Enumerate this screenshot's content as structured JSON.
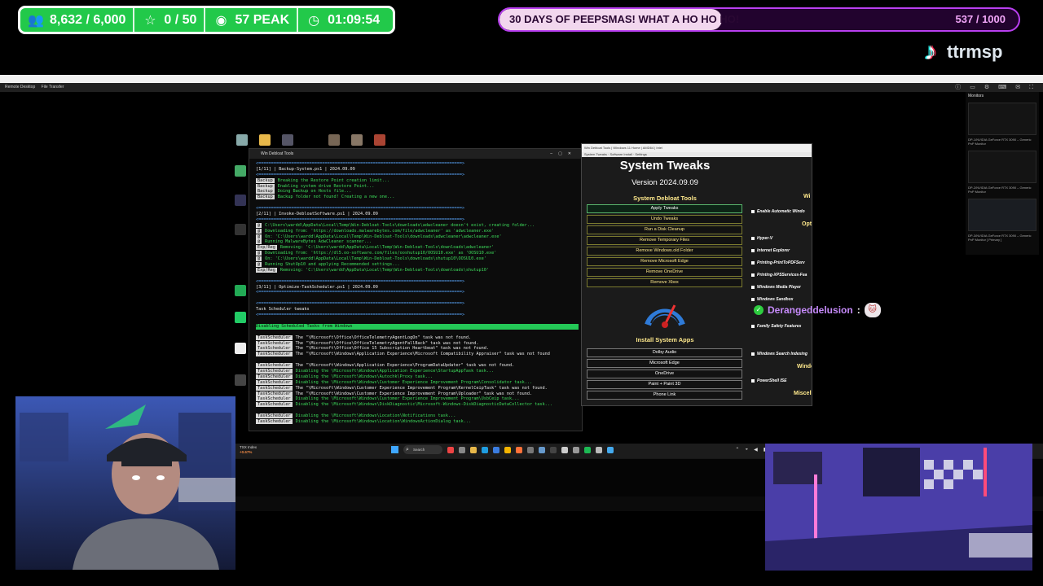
{
  "overlay": {
    "stats": [
      {
        "icon": "users-icon",
        "glyph": "👥",
        "value": "8,632 / 6,000"
      },
      {
        "icon": "star-icon",
        "glyph": "☆",
        "value": "0 / 50"
      },
      {
        "icon": "eye-icon",
        "glyph": "◉",
        "value": "57 PEAK"
      },
      {
        "icon": "clock-icon",
        "glyph": "◷",
        "value": "01:09:54"
      }
    ],
    "goal": {
      "title": "30 DAYS OF PEEPSMAS! WHAT A HO HO HO!",
      "count": "537 / 1000",
      "progress": 0.537
    },
    "tiktok_handle": "ttrmsp",
    "colors": {
      "accent_green": "#22c94a",
      "goal_purple": "#b93ff0",
      "chat_name": "#c58af9"
    }
  },
  "remote": {
    "menu": [
      "Remote Desktop",
      "File Transfer"
    ],
    "monitors_title": "Monitors",
    "monitor_captions": [
      "DP-1/NVIDIA GeForce RTX 3090 – Generic PnP Monitor",
      "DP-2/NVIDIA GeForce RTX 3090 – Generic PnP Monitor",
      "DP-3/NVIDIA GeForce RTX 3090 – Generic PnP Monitor [ Primary ]"
    ]
  },
  "terminal": {
    "tab_title": "Win Debloat Tools",
    "lines": [
      {
        "kind": "sep",
        "text": "<================================================================================>"
      },
      {
        "kind": "head",
        "text": "[1/11] | Backup-System.ps1 | 2024.09.09"
      },
      {
        "kind": "sep",
        "text": "<================================================================================>"
      },
      {
        "kind": "tag",
        "tag": "Backup",
        "text": "Breaking the Restore Point creation limit..."
      },
      {
        "kind": "tag",
        "tag": "Backup",
        "text": "Enabling system drive Restore Point..."
      },
      {
        "kind": "tag",
        "tag": "Backup",
        "text": "Doing Backup on Hosts file..."
      },
      {
        "kind": "tag",
        "tag": "Backup",
        "text": "Backup folder not found! Creating a new one..."
      },
      {
        "kind": "blank",
        "text": ""
      },
      {
        "kind": "sep",
        "text": "<================================================================================>"
      },
      {
        "kind": "head",
        "text": "[2/11] | Invoke-DebloatSoftware.ps1 | 2024.09.09"
      },
      {
        "kind": "sep",
        "text": "<================================================================================>"
      },
      {
        "kind": "tag",
        "tag": "@",
        "text": "C:\\Users\\wardd\\AppData\\Local\\Temp\\Win-Debloat-Tools\\downloads\\adwcleaner doesn't exist, creating folder..."
      },
      {
        "kind": "tag",
        "tag": "@",
        "text": "Downloading from: 'https://downloads.malwarebytes.com/file/adwcleaner' as 'adwcleaner.exe'"
      },
      {
        "kind": "tag",
        "tag": "@",
        "text": "On: 'C:\\Users\\wardd\\AppData\\Local\\Temp\\Win-Debloat-Tools\\downloads\\adwcleaner\\adwcleaner.exe'"
      },
      {
        "kind": "tag",
        "tag": "@",
        "text": "Running MalwareBytes AdwCleaner scanner..."
      },
      {
        "kind": "tag",
        "tag": "Exp/Reg",
        "text": "Removing: 'C:\\Users\\wardd\\AppData\\Local\\Temp\\Win-Debloat-Tools\\downloads\\adwcleaner'"
      },
      {
        "kind": "tag",
        "tag": "@",
        "text": "Downloading from: 'https://dl5.oo-software.com/files/ooshutup10/OOSU10.exe' as 'OOSU10.exe'"
      },
      {
        "kind": "tag",
        "tag": "@",
        "text": "On: 'C:\\Users\\wardd\\AppData\\Local\\Temp\\Win-Debloat-Tools\\downloads\\shutup10\\OOSU10.exe'"
      },
      {
        "kind": "tag",
        "tag": "@",
        "text": "Running ShutUp10 and applying Recommended settings..."
      },
      {
        "kind": "tag",
        "tag": "Exp/Reg",
        "text": "Removing: 'C:\\Users\\wardd\\AppData\\Local\\Temp\\Win-Debloat-Tools\\downloads\\shutup10'"
      },
      {
        "kind": "blank",
        "text": ""
      },
      {
        "kind": "sep",
        "text": "<================================================================================>"
      },
      {
        "kind": "head",
        "text": "[3/11] | Optimize-TaskScheduler.ps1 | 2024.09.09"
      },
      {
        "kind": "sep",
        "text": "<================================================================================>"
      },
      {
        "kind": "blank",
        "text": ""
      },
      {
        "kind": "sep",
        "text": "<================================================================================>"
      },
      {
        "kind": "head",
        "text": "Task Scheduler tweaks"
      },
      {
        "kind": "sep",
        "text": "<================================================================================>"
      },
      {
        "kind": "blank",
        "text": ""
      },
      {
        "kind": "hl",
        "text": "Disabling Scheduled Tasks from Windows"
      },
      {
        "kind": "blank",
        "text": ""
      },
      {
        "kind": "task",
        "tag": "TaskScheduler",
        "text": "The \"\\Microsoft\\Office\\OfficeTelemetryAgentLogOn\" task was not found."
      },
      {
        "kind": "task",
        "tag": "TaskScheduler",
        "text": "The \"\\Microsoft\\Office\\OfficeTelemetryAgentFallBack\" task was not found."
      },
      {
        "kind": "task",
        "tag": "TaskScheduler",
        "text": "The \"\\Microsoft\\Office\\Office 15 Subscription Heartbeat\" task was not found."
      },
      {
        "kind": "task",
        "tag": "TaskScheduler",
        "text": "The \"\\Microsoft\\Windows\\Application Experience\\Microsoft Compatibility Appraiser\" task was not found"
      },
      {
        "kind": "blank",
        "text": ""
      },
      {
        "kind": "task",
        "tag": "TaskScheduler",
        "text": "The \"\\Microsoft\\Windows\\Application Experience\\ProgramDataUpdater\" task was not found."
      },
      {
        "kind": "task2",
        "tag": "TaskScheduler",
        "text": "Disabling the \\Microsoft\\Windows\\Application Experience\\StartupAppTask task..."
      },
      {
        "kind": "task2",
        "tag": "TaskScheduler",
        "text": "Disabling the \\Microsoft\\Windows\\Autochk\\Proxy task..."
      },
      {
        "kind": "task2",
        "tag": "TaskScheduler",
        "text": "Disabling the \\Microsoft\\Windows\\Customer Experience Improvement Program\\Consolidator task..."
      },
      {
        "kind": "task",
        "tag": "TaskScheduler",
        "text": "The \"\\Microsoft\\Windows\\Customer Experience Improvement Program\\KernelCeipTask\" task was not found."
      },
      {
        "kind": "task",
        "tag": "TaskScheduler",
        "text": "The \"\\Microsoft\\Windows\\Customer Experience Improvement Program\\Uploader\" task was not found."
      },
      {
        "kind": "task2",
        "tag": "TaskScheduler",
        "text": "Disabling the \\Microsoft\\Windows\\Customer Experience Improvement Program\\UsbCeip task..."
      },
      {
        "kind": "task2",
        "tag": "TaskScheduler",
        "text": "Disabling the \\Microsoft\\Windows\\DiskDiagnostic\\Microsoft-Windows-DiskDiagnosticDataCollector task..."
      },
      {
        "kind": "blank",
        "text": ""
      },
      {
        "kind": "task2",
        "tag": "TaskScheduler",
        "text": "Disabling the \\Microsoft\\Windows\\Location\\Notifications task..."
      },
      {
        "kind": "task2",
        "tag": "TaskScheduler",
        "text": "Disabling the \\Microsoft\\Windows\\Location\\WindowsActionDialog task..."
      }
    ]
  },
  "winutil": {
    "title": "System Tweaks",
    "version": "Version 2024.09.09",
    "debloat_heading": "System Debloat Tools",
    "debloat_buttons": [
      "Apply Tweaks",
      "Undo Tweaks",
      "Run a Disk Cleanup",
      "Remove Temporary Files",
      "Remove Windows.old Folder",
      "Remove Microsoft Edge",
      "Remove OneDrive",
      "Remove Xbox"
    ],
    "apps_heading": "Install System Apps",
    "app_buttons": [
      "Dolby Audio",
      "Microsoft Edge",
      "OneDrive",
      "Paint + Paint 3D",
      "Phone Link"
    ],
    "right_options": [
      "Enable Automatic Windo",
      "Hyper-V",
      "Internet Explorer",
      "Printing-PrintToPDFServ",
      "Printing-XPSServices-Fea",
      "Windows Media Player",
      "Windows Sandbox",
      "Family Safety Features",
      "Windows Search Indexing",
      "PowerShell ISE"
    ],
    "right_heads": [
      "Wi",
      "Opt",
      "Windo",
      "Miscell"
    ]
  },
  "chat": {
    "username": "Derangeddelusion",
    "separator": ":"
  },
  "taskbar": {
    "weather_temp": "TSX Index",
    "weather_detail": "+0.67%",
    "search_label": "Search"
  }
}
